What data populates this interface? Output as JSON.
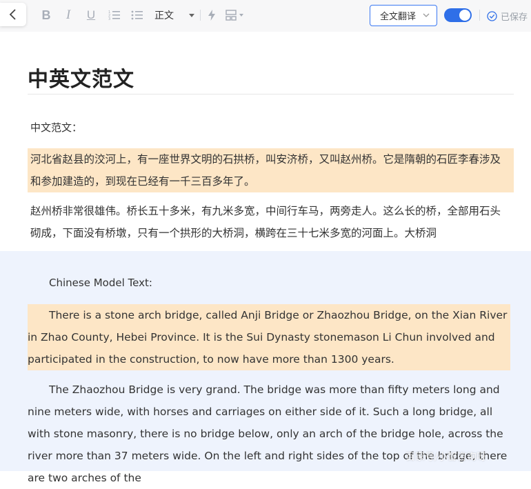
{
  "toolbar": {
    "back_icon": "chevron-left-icon",
    "bold_label": "B",
    "italic_label": "I",
    "underline_label": "U",
    "paragraph_style": "正文",
    "translate_label": "全文翻译",
    "toggle_on": true,
    "saved_label": "已保存",
    "accent_color": "#2f6fe8"
  },
  "document": {
    "title": "中英文范文",
    "cn_label": "中文范文：",
    "cn_paragraphs": [
      "河北省赵县的洨河上，有一座世界文明的石拱桥，叫安济桥，又叫赵州桥。它是隋朝的石匠李春涉及和参加建造的，到现在已经有一千三百多年了。",
      "赵州桥非常很雄伟。桥长五十多米，有九米多宽，中间行车马，两旁走人。这么长的桥，全部用石头砌成，下面没有桥墩，只有一个拱形的大桥洞，横跨在三十七米多宽的河面上。大桥洞"
    ]
  },
  "translation": {
    "en_label": "Chinese Model Text:",
    "en_paragraphs": [
      "There is a stone arch bridge, called Anji Bridge or Zhaozhou Bridge, on the Xian River in Zhao County, Hebei Province. It is the Sui Dynasty stonemason Li Chun involved and participated in the construction, to now have more than 1300 years.",
      "The Zhaozhou Bridge is very grand. The bridge was more than fifty meters long and nine meters wide, with horses and carriages on either side of it. Such a long bridge, all with stone masonry, there is no bridge below, only an arch of the bridge hole, across the river more than 37 meters wide. On the left and right sides of the top of the bridge, there are two arches of the"
    ],
    "highlight_color": "#fde6c6",
    "pane_color": "#eef3fd"
  },
  "watermark": "百家号/小智咨询呀"
}
